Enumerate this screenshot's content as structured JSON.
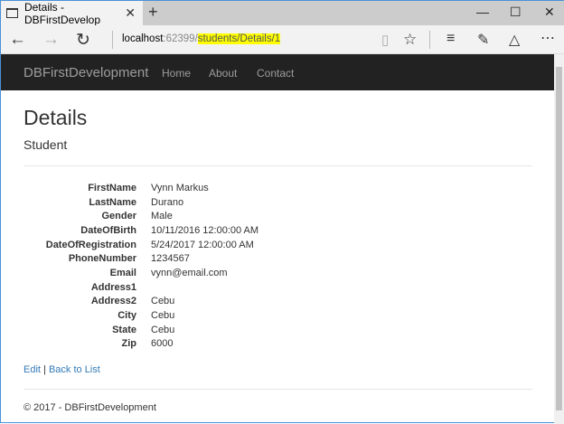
{
  "browser": {
    "tab_title": "Details - DBFirstDevelop",
    "url_host": "localhost",
    "url_port": ":62399/",
    "url_path": "students/Details/1",
    "icons": [
      "back-icon",
      "forward-icon",
      "refresh-icon",
      "reading-view-icon",
      "favorite-star-icon",
      "hub-icon",
      "web-note-icon",
      "share-icon",
      "more-icon"
    ]
  },
  "navbar": {
    "brand": "DBFirstDevelopment",
    "links": [
      "Home",
      "About",
      "Contact"
    ]
  },
  "page": {
    "title": "Details",
    "subtitle": "Student",
    "fields": [
      {
        "label": "FirstName",
        "value": "Vynn Markus"
      },
      {
        "label": "LastName",
        "value": "Durano"
      },
      {
        "label": "Gender",
        "value": "Male"
      },
      {
        "label": "DateOfBirth",
        "value": "10/11/2016 12:00:00 AM"
      },
      {
        "label": "DateOfRegistration",
        "value": "5/24/2017 12:00:00 AM"
      },
      {
        "label": "PhoneNumber",
        "value": "1234567"
      },
      {
        "label": "Email",
        "value": "vynn@email.com"
      },
      {
        "label": "Address1",
        "value": ""
      },
      {
        "label": "Address2",
        "value": "Cebu"
      },
      {
        "label": "City",
        "value": "Cebu"
      },
      {
        "label": "State",
        "value": "Cebu"
      },
      {
        "label": "Zip",
        "value": "6000"
      }
    ],
    "edit": "Edit",
    "separator": "|",
    "back": "Back to List"
  },
  "footer": "© 2017 - DBFirstDevelopment"
}
